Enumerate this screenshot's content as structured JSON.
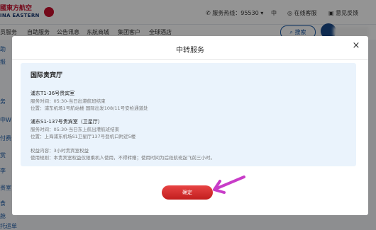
{
  "header": {
    "logo_cn": "國東方航空",
    "logo_en": "INA EASTERN",
    "hotline_label": "服务热线：95530",
    "language": "中",
    "online_service": "在线客服",
    "feedback": "意见反馈"
  },
  "nav": {
    "items": [
      "员服务",
      "自助服务",
      "公告讯息",
      "东航商城",
      "集团客户",
      "全球酒店"
    ],
    "search_label": "搜索"
  },
  "sidebar": {
    "items": [
      "助",
      "报",
      "务",
      "中W",
      "付费",
      "赏",
      "李",
      "贵室",
      "食",
      "舱",
      "托运单"
    ]
  },
  "dialog": {
    "title": "中转服务",
    "close_icon": "close-icon",
    "section_title": "国际贵宾厅",
    "halls": [
      {
        "name": "浦东T1-36号贵宾室",
        "time": "服务时间：05:30-当日出港航班结束",
        "location": "位置：浦东机场1号航站楼 国际出发108/11号安检通道处"
      },
      {
        "name": "浦东S1-137号贵宾室（卫星厅）",
        "time": "服务时间：05:30-当日东上航出港航班结束",
        "location": "位置：上海浦东机场S1卫星厅137号登机口附近5楼"
      }
    ],
    "benefit": "权益内容：3小时贵宾室权益",
    "rule": "使用规则：本贵宾室权益仅限乘机人使用，不得转赠；使用时间为后段航班起飞前三小时。",
    "confirm_label": "确定"
  },
  "colors": {
    "brand_red": "#c8102e",
    "brand_blue": "#1a5aa6",
    "panel_bg": "#eaf3fc",
    "annotation_arrow": "#c83cc8"
  }
}
